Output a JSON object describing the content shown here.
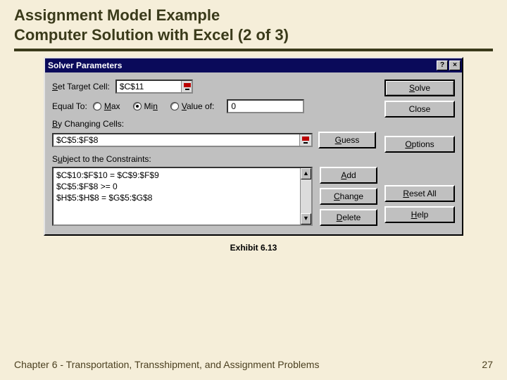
{
  "slide": {
    "title_line1": "Assignment Model Example",
    "title_line2": "Computer Solution with Excel (2 of 3)",
    "exhibit": "Exhibit 6.13",
    "footer_left": "Chapter 6 - Transportation, Transshipment, and Assignment Problems",
    "footer_right": "27"
  },
  "dialog": {
    "title": "Solver Parameters",
    "help_btn": "?",
    "close_btn": "×",
    "labels": {
      "set_target": "Set Target Cell:",
      "equal_to": "Equal To:",
      "max": "Max",
      "min": "Min",
      "value_of": "Value of:",
      "by_changing": "By Changing Cells:",
      "subject_to": "Subject to the Constraints:"
    },
    "target_cell": "$C$11",
    "value_of_value": "0",
    "changing_cells": "$C$5:$F$8",
    "constraints": [
      "$C$10:$F$10 = $C$9:$F$9",
      "$C$5:$F$8 >= 0",
      "$H$5:$H$8 = $G$5:$G$8"
    ],
    "buttons": {
      "solve": "Solve",
      "close": "Close",
      "options": "Options",
      "reset": "Reset All",
      "help": "Help",
      "guess": "Guess",
      "add": "Add",
      "change": "Change",
      "delete": "Delete"
    }
  }
}
